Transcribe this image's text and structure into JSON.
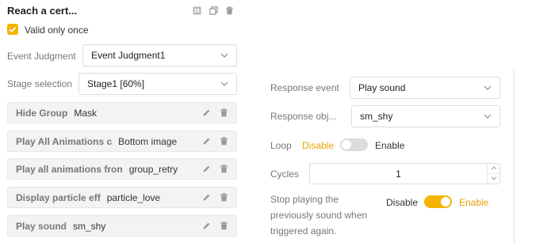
{
  "header": {
    "title": "Reach a cert...",
    "icons": [
      "hash-icon",
      "copy-icon",
      "trash-icon"
    ]
  },
  "valid_once": {
    "checked": true,
    "label": "Valid only once"
  },
  "event_judgment": {
    "label": "Event Judgment",
    "value": "Event Judgment1"
  },
  "stage_selection": {
    "label": "Stage selection",
    "value": "Stage1 [60%]"
  },
  "actions": [
    {
      "type": "Hide Group",
      "target": "Mask"
    },
    {
      "type": "Play All Animations c",
      "target": "Bottom image"
    },
    {
      "type": "Play all animations fron",
      "target": "group_retry"
    },
    {
      "type": "Display particle eff",
      "target": "particle_love"
    },
    {
      "type": "Play sound",
      "target": "sm_shy"
    }
  ],
  "response": {
    "event_label": "Response event",
    "event_value": "Play sound",
    "object_label": "Response obj...",
    "object_value": "sm_shy",
    "loop_label": "Loop",
    "loop_disable": "Disable",
    "loop_enable": "Enable",
    "loop_enabled": false,
    "cycles_label": "Cycles",
    "cycles_value": "1",
    "stop_label": "Stop playing the previously sound when triggered again.",
    "stop_disable": "Disable",
    "stop_enable": "Enable",
    "stop_enabled": true
  },
  "colors": {
    "accent": "#f5b400",
    "accent_text": "#e6a300",
    "row_bg": "#f2f3f5"
  }
}
